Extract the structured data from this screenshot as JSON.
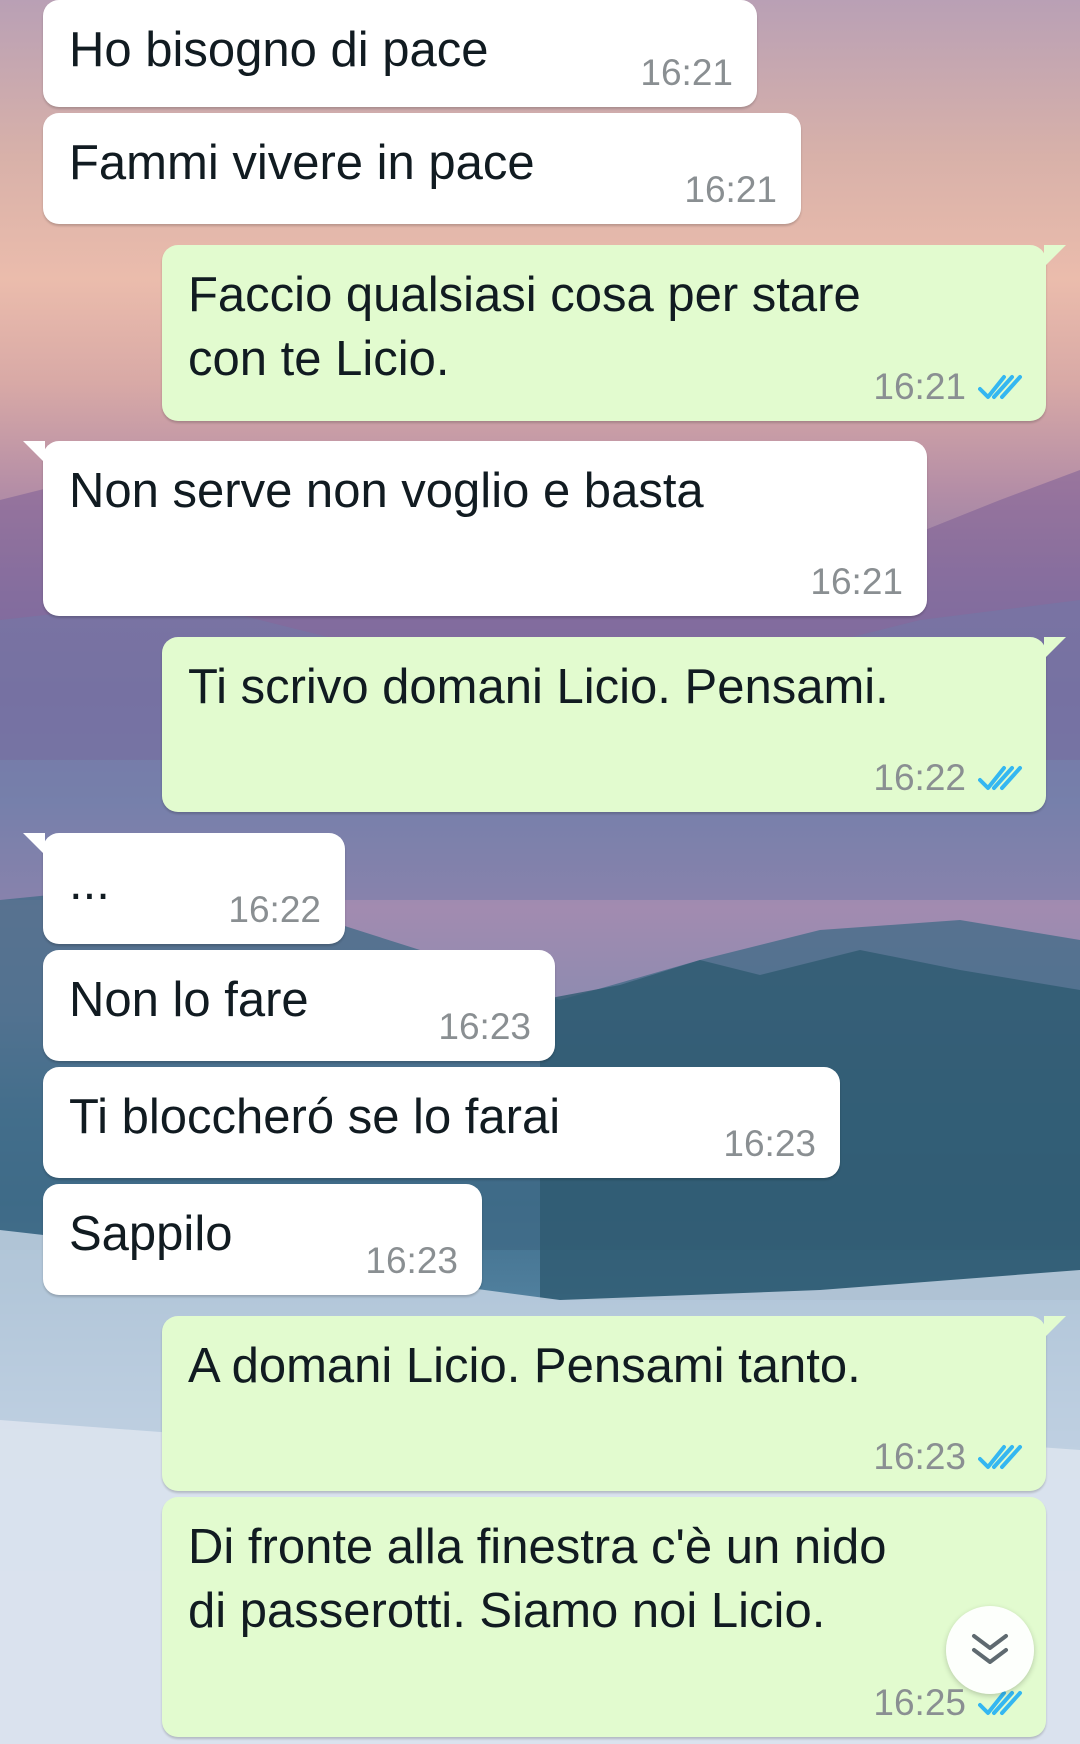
{
  "chat": {
    "messages": [
      {
        "direction": "in",
        "text": "Ho bisogno di pace",
        "time": "16:21"
      },
      {
        "direction": "in",
        "text": "Fammi vivere in pace",
        "time": "16:21"
      },
      {
        "direction": "out",
        "text": "Faccio qualsiasi cosa per stare\ncon te Licio.",
        "time": "16:21",
        "status": "read"
      },
      {
        "direction": "in",
        "text": "Non serve non voglio e basta",
        "time": "16:21"
      },
      {
        "direction": "out",
        "text": "Ti scrivo domani Licio. Pensami.",
        "time": "16:22",
        "status": "read"
      },
      {
        "direction": "in",
        "text": "...",
        "time": "16:22"
      },
      {
        "direction": "in",
        "text": "Non lo fare",
        "time": "16:23"
      },
      {
        "direction": "in",
        "text": "Ti bloccheró se lo farai",
        "time": "16:23"
      },
      {
        "direction": "in",
        "text": "Sappilo",
        "time": "16:23"
      },
      {
        "direction": "out",
        "text": "A domani Licio. Pensami tanto.",
        "time": "16:23",
        "status": "read"
      },
      {
        "direction": "out",
        "text": "Di fronte alla finestra c'è un nido\ndi passerotti. Siamo noi Licio.",
        "time": "16:25",
        "status": "read"
      }
    ]
  },
  "icons": {
    "read_receipt": "double-check-icon",
    "scroll_down": "double-chevron-down-icon"
  },
  "colors": {
    "incoming_bubble": "#ffffff",
    "outgoing_bubble": "#e2fbcf",
    "read_tick": "#34b7f1",
    "timestamp": "#8a8f92",
    "text": "#111b21"
  }
}
